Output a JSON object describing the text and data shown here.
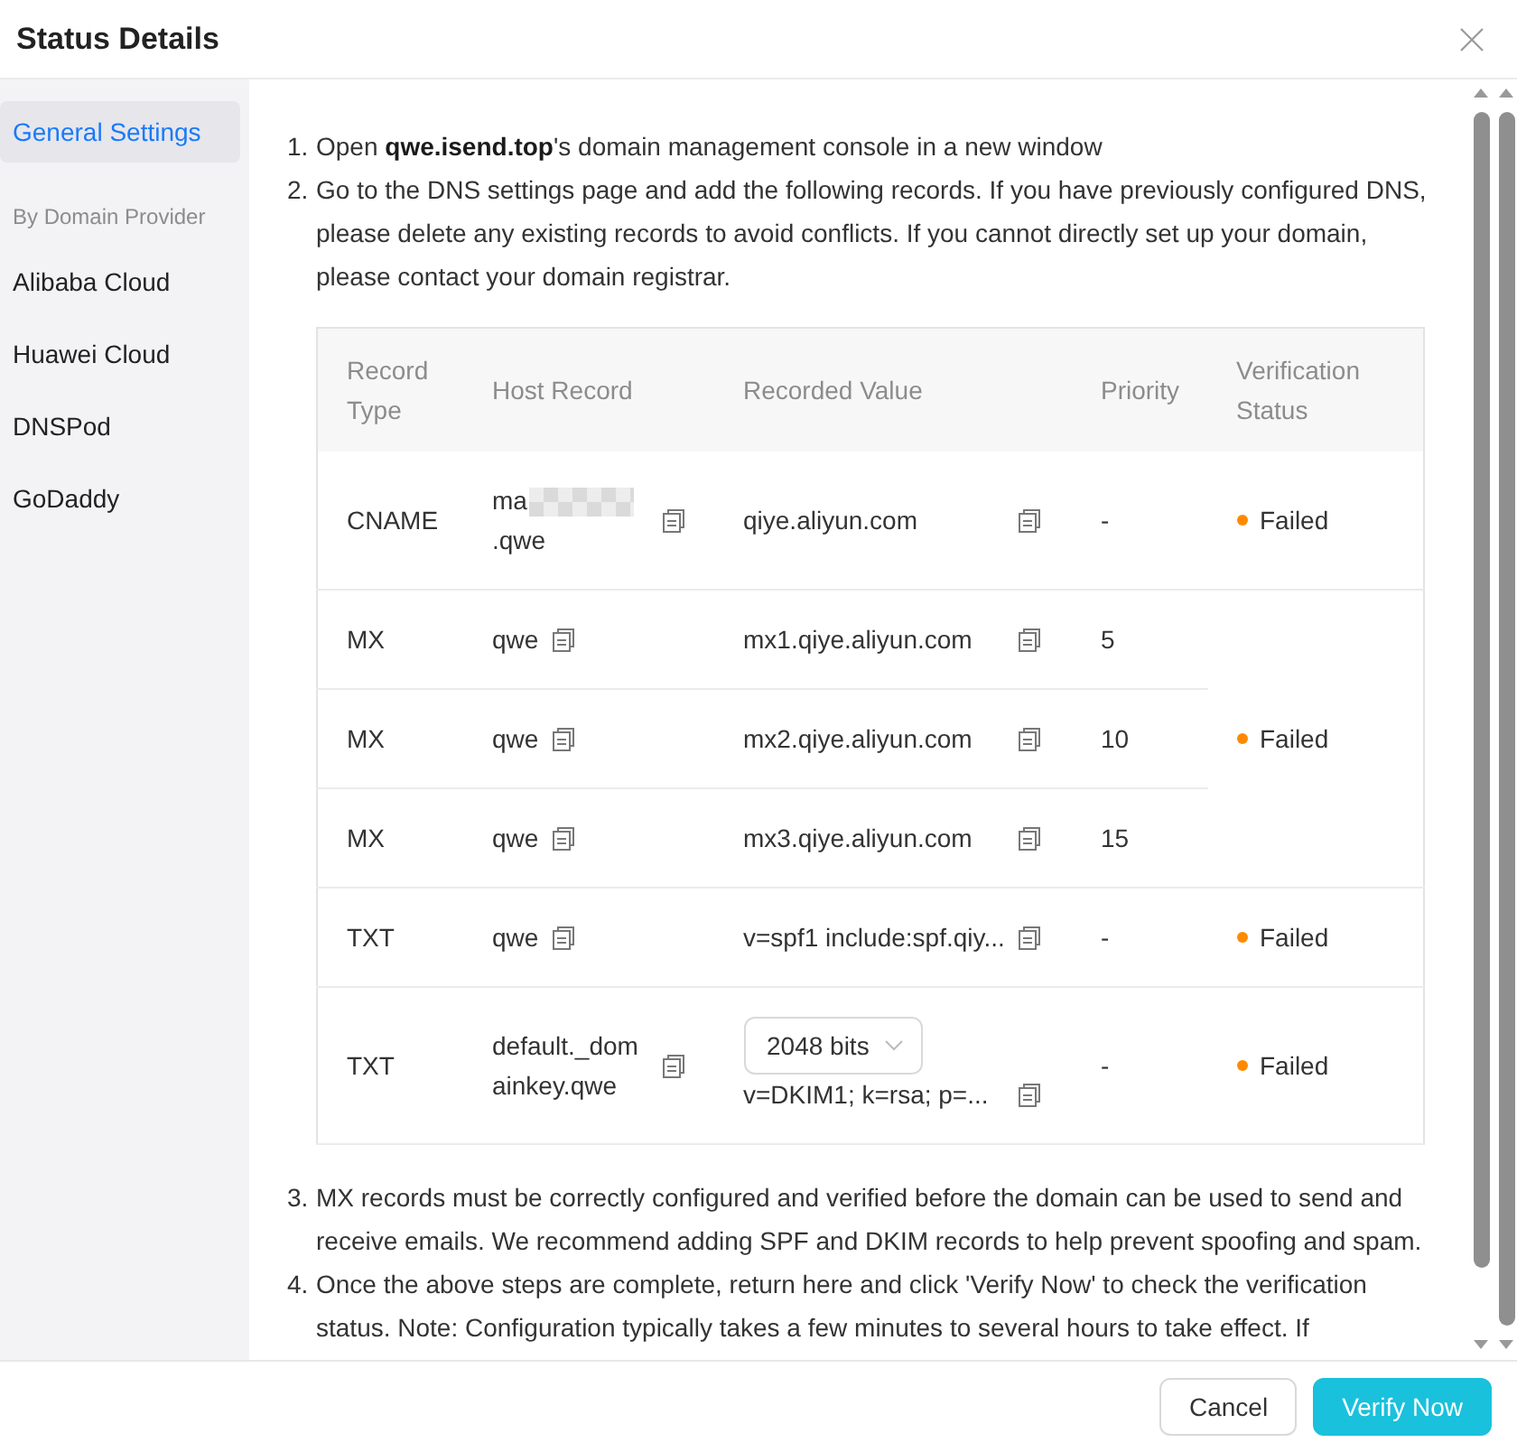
{
  "dialog": {
    "title": "Status Details"
  },
  "sidebar": {
    "items": [
      {
        "kind": "link",
        "label": "General Settings",
        "selected": true
      },
      {
        "kind": "heading",
        "label": "By Domain Provider"
      },
      {
        "kind": "link",
        "label": "Alibaba Cloud",
        "selected": false
      },
      {
        "kind": "link",
        "label": "Huawei Cloud",
        "selected": false
      },
      {
        "kind": "link",
        "label": "DNSPod",
        "selected": false
      },
      {
        "kind": "link",
        "label": "GoDaddy",
        "selected": false
      }
    ]
  },
  "steps_before": [
    {
      "number": "1.",
      "text": "Open **qwe.isend.top**'s domain management console in a new window"
    },
    {
      "number": "2.",
      "text": "Go to the DNS settings page and add the following records. If you have previously configured DNS, please delete any existing records to avoid conflicts. If you cannot directly set up your domain, please contact your domain registrar."
    }
  ],
  "dns_table": {
    "columns": [
      "Record Type",
      "Host Record",
      "Recorded Value",
      "Priority",
      "Verification Status"
    ],
    "groups": [
      {
        "status": "Failed",
        "records": [
          {
            "type": "CNAME",
            "host": "ma",
            "host_masked": true,
            "host_after_mask": ".qwe",
            "value": "qiye.aliyun.com",
            "priority": "-"
          }
        ]
      },
      {
        "status": "Failed",
        "records": [
          {
            "type": "MX",
            "host": "qwe",
            "value": "mx1.qiye.aliyun.com",
            "priority": "5"
          },
          {
            "type": "MX",
            "host": "qwe",
            "value": "mx2.qiye.aliyun.com",
            "priority": "10"
          },
          {
            "type": "MX",
            "host": "qwe",
            "value": "mx3.qiye.aliyun.com",
            "priority": "15"
          }
        ]
      },
      {
        "status": "Failed",
        "records": [
          {
            "type": "TXT",
            "host": "qwe",
            "value": "v=spf1 include:spf.qiy...",
            "priority": "-"
          }
        ]
      },
      {
        "status": "Failed",
        "records": [
          {
            "type": "TXT",
            "host": "default._domainkey.qwe",
            "key_size": "2048 bits",
            "value": "v=DKIM1; k=rsa; p=...",
            "priority": "-"
          }
        ]
      }
    ]
  },
  "steps_after": [
    {
      "number": "3.",
      "text": "MX records must be correctly configured and verified before the domain can be used to send and receive emails. We recommend adding SPF and DKIM records to help prevent spoofing and spam."
    },
    {
      "number": "4.",
      "text": "Once the above steps are complete, return here and click 'Verify Now' to check the verification status. Note: Configuration typically takes a few minutes to several hours to take effect. If"
    }
  ],
  "footer": {
    "buttons": [
      {
        "kind": "secondary",
        "label": "Cancel"
      },
      {
        "kind": "primary",
        "label": "Verify Now"
      }
    ]
  }
}
